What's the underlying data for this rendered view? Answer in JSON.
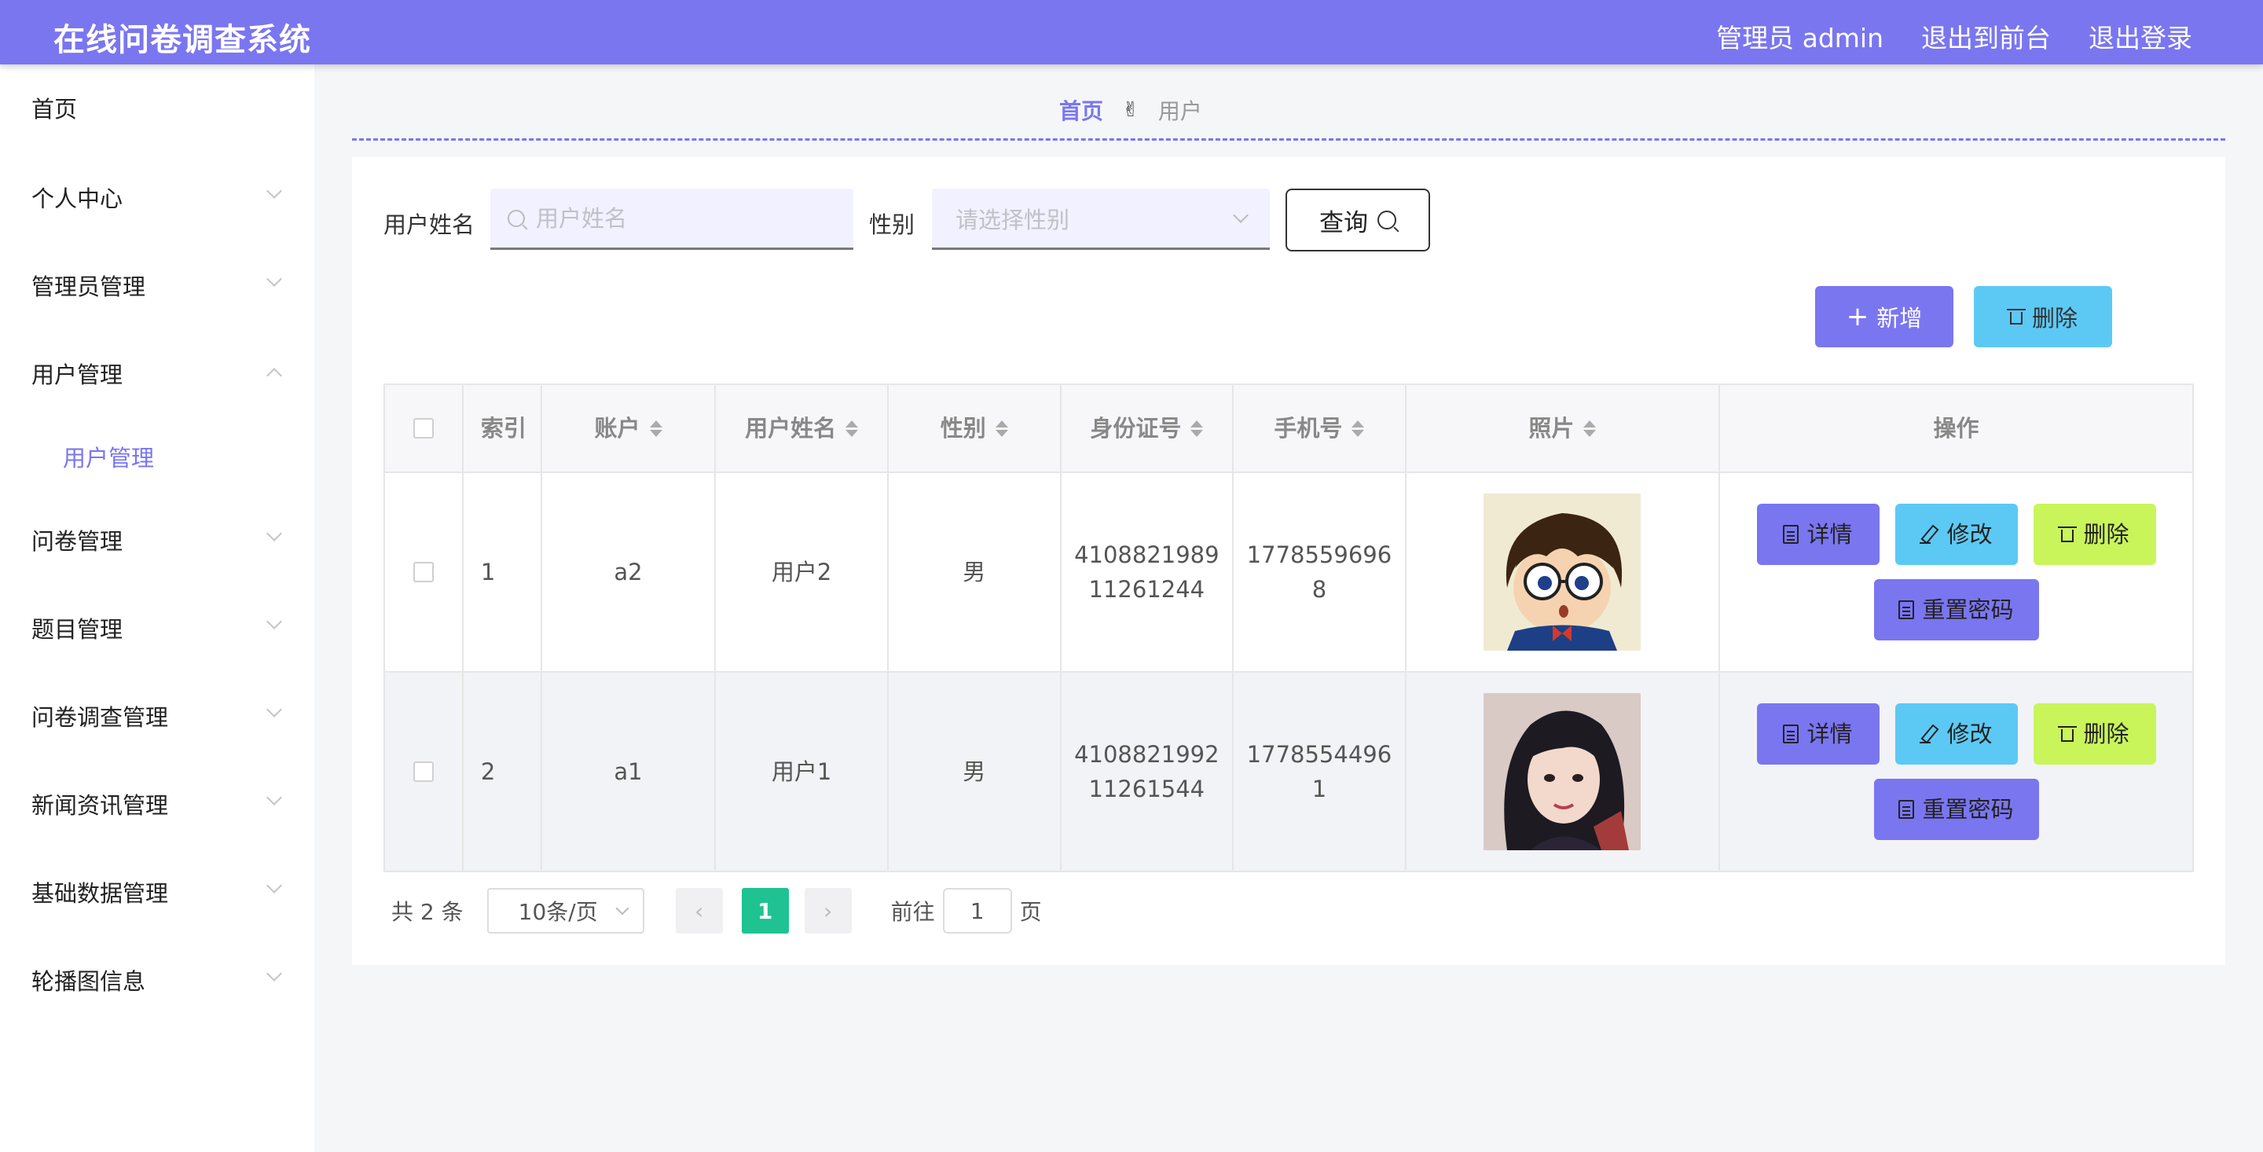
{
  "header": {
    "title": "在线问卷调查系统",
    "links": [
      "管理员 admin",
      "退出到前台",
      "退出登录"
    ]
  },
  "sidebar": {
    "items": [
      {
        "label": "首页"
      },
      {
        "label": "个人中心"
      },
      {
        "label": "管理员管理"
      },
      {
        "label": "用户管理"
      },
      {
        "label": "问卷管理"
      },
      {
        "label": "题目管理"
      },
      {
        "label": "问卷调查管理"
      },
      {
        "label": "新闻资讯管理"
      },
      {
        "label": "基础数据管理"
      },
      {
        "label": "轮播图信息"
      }
    ],
    "submenu_active": "用户管理"
  },
  "breadcrumb": {
    "home": "首页",
    "separator": "✌",
    "current": "用户"
  },
  "search": {
    "name_label": "用户姓名",
    "name_placeholder": "用户姓名",
    "sex_label": "性别",
    "sex_placeholder": "请选择性别",
    "query_label": "查询"
  },
  "actions": {
    "add_label": "新增",
    "delete_label": "删除"
  },
  "table": {
    "headers": [
      "索引",
      "账户",
      "用户姓名",
      "性别",
      "身份证号",
      "手机号",
      "照片",
      "操作"
    ],
    "rows": [
      {
        "index": "1",
        "account": "a2",
        "name": "用户2",
        "sex": "男",
        "id_line1": "4108821989",
        "id_line2": "11261244",
        "phone_line1": "1778559696",
        "phone_line2": "8",
        "photo": "cartoon-boy-glasses"
      },
      {
        "index": "2",
        "account": "a1",
        "name": "用户1",
        "sex": "男",
        "id_line1": "4108821992",
        "id_line2": "11261544",
        "phone_line1": "1778554496",
        "phone_line2": "1",
        "photo": "girl-portrait"
      }
    ],
    "op_labels": {
      "detail": "详情",
      "edit": "修改",
      "delete": "删除",
      "reset": "重置密码"
    }
  },
  "pagination": {
    "total_text": "共 2 条",
    "page_size": "10条/页",
    "current_page": "1",
    "goto_label": "前往",
    "goto_value": "1",
    "page_suffix": "页"
  },
  "colors": {
    "primary": "#7a76f0",
    "info": "#5cc9f5",
    "lime": "#c9f55a",
    "page_active": "#1ec391"
  }
}
